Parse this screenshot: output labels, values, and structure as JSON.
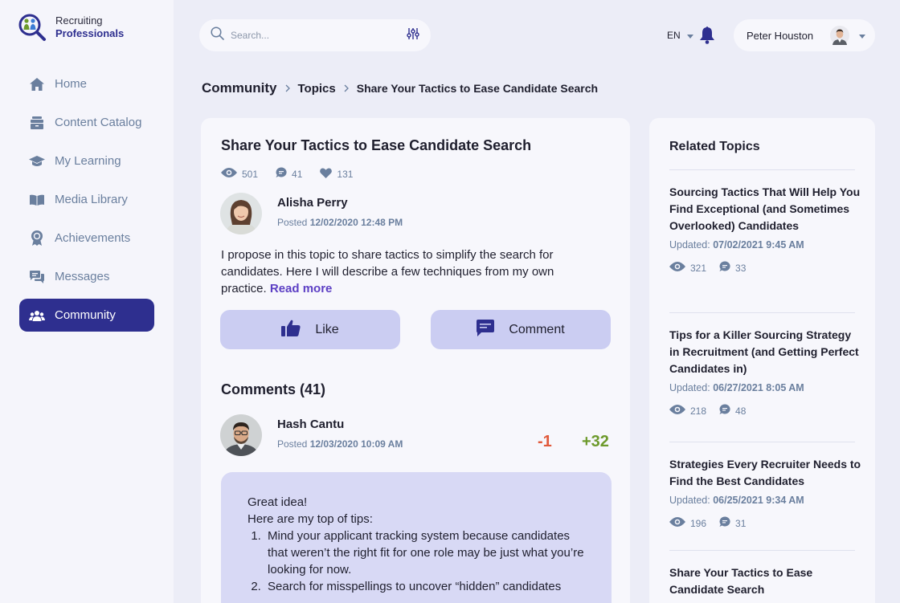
{
  "brand": {
    "line1": "Recruiting",
    "line2": "Professionals"
  },
  "nav": {
    "items": [
      {
        "label": "Home",
        "icon": "home-icon"
      },
      {
        "label": "Content Catalog",
        "icon": "catalog-icon"
      },
      {
        "label": "My Learning",
        "icon": "graduation-cap-icon"
      },
      {
        "label": "Media Library",
        "icon": "book-icon"
      },
      {
        "label": "Achievements",
        "icon": "award-icon"
      },
      {
        "label": "Messages",
        "icon": "chat-icon"
      },
      {
        "label": "Community",
        "icon": "people-icon"
      }
    ],
    "active": "Community"
  },
  "header": {
    "search_placeholder": "Search...",
    "language": "EN",
    "user_name": "Peter Houston"
  },
  "breadcrumb": {
    "root": "Community",
    "mid": "Topics",
    "current": "Share Your Tactics to Ease Candidate Search"
  },
  "post": {
    "title": "Share Your Tactics to Ease Candidate Search",
    "views": "501",
    "comments": "41",
    "likes": "131",
    "author": "Alisha Perry",
    "posted_label": "Posted",
    "posted_date": "12/02/2020 12:48 PM",
    "body": "I propose in this topic to share tactics to simplify the search for candidates. Here I will describe a few techniques from my own practice.",
    "read_more": "Read more",
    "like_label": "Like",
    "comment_label": "Comment"
  },
  "comments": {
    "title": "Comments (41)",
    "first": {
      "author": "Hash Cantu",
      "posted_label": "Posted",
      "posted_date": "12/03/2020 10:09 AM",
      "downvotes": "-1",
      "upvotes": "+32",
      "line1": "Great idea!",
      "line2": "Here are my top of tips:",
      "tips": [
        "Mind your applicant tracking system because candidates that weren’t the right fit for one role may be just what you’re looking for now.",
        "Search for misspellings to uncover “hidden” candidates"
      ]
    }
  },
  "related": {
    "title": "Related Topics",
    "updated_label": "Updated:",
    "items": [
      {
        "title": "Sourcing Tactics That Will Help You Find Exceptional (and Sometimes Overlooked) Candidates",
        "updated": "07/02/2021 9:45 AM",
        "views": "321",
        "comments": "33"
      },
      {
        "title": "Tips for a Killer Sourcing Strategy in Recruitment (and Getting Perfect Candidates in)",
        "updated": "06/27/2021 8:05 AM",
        "views": "218",
        "comments": "48"
      },
      {
        "title": "Strategies Every Recruiter Needs to Find the Best Candidates",
        "updated": "06/25/2021 9:34 AM",
        "views": "196",
        "comments": "31"
      },
      {
        "title": "Share Your Tactics to Ease Candidate Search"
      }
    ]
  },
  "colors": {
    "primary": "#2e2f8f",
    "accent": "#5c3fc4",
    "downvote": "#e15a3c",
    "upvote": "#6d9a2c",
    "muted": "#6a7f9e"
  }
}
